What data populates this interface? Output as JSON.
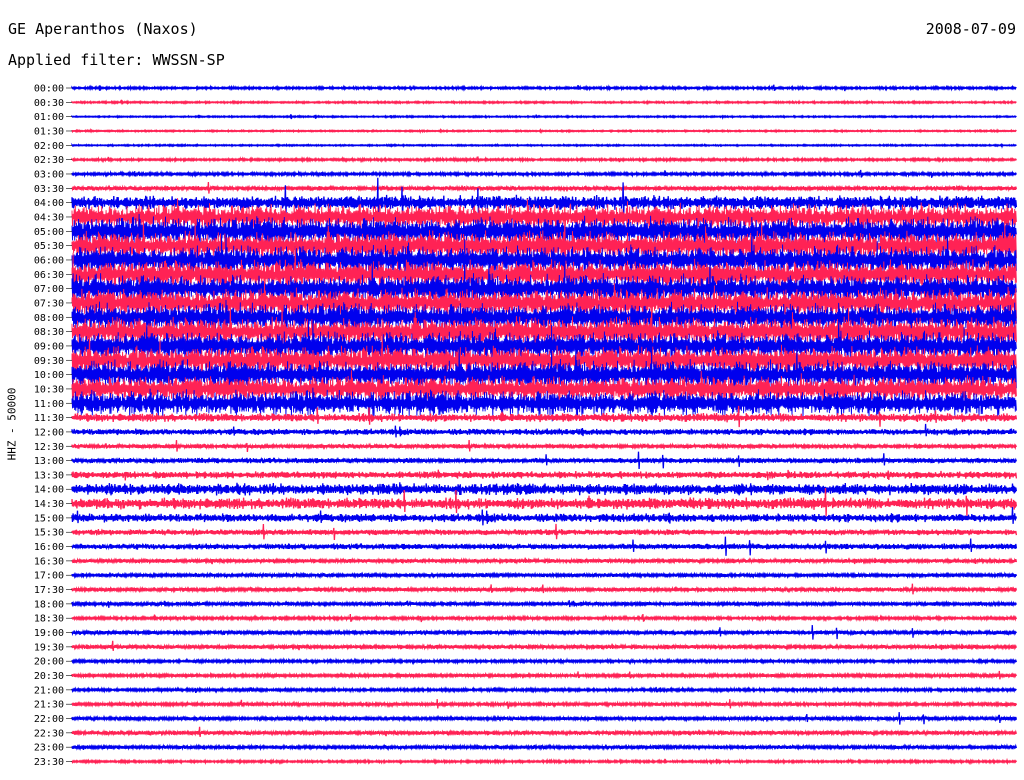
{
  "header": {
    "station": "GE Aperanthos (Naxos)",
    "date": "2008-07-09",
    "filter": "Applied filter: WWSSN-SP"
  },
  "colors": {
    "trace_a": "#0000ee",
    "trace_b": "#ff2255",
    "background": "#ffffff",
    "text": "#000000"
  },
  "chart_data": {
    "type": "line",
    "title": "GE Aperanthos (Naxos)",
    "subtitle": "Applied filter: WWSSN-SP",
    "date": "2008-07-09",
    "ylabel": "HHZ - 50000",
    "xlabel": "",
    "grid": false,
    "legend": "none",
    "rows": [
      {
        "label": "00:00",
        "color": "blue",
        "amplitude": 0.08
      },
      {
        "label": "00:30",
        "color": "red",
        "amplitude": 0.06
      },
      {
        "label": "01:00",
        "color": "blue",
        "amplitude": 0.05
      },
      {
        "label": "01:30",
        "color": "red",
        "amplitude": 0.05
      },
      {
        "label": "02:00",
        "color": "blue",
        "amplitude": 0.05
      },
      {
        "label": "02:30",
        "color": "red",
        "amplitude": 0.08
      },
      {
        "label": "03:00",
        "color": "blue",
        "amplitude": 0.1
      },
      {
        "label": "03:30",
        "color": "red",
        "amplitude": 0.15
      },
      {
        "label": "04:00",
        "color": "blue",
        "amplitude": 0.5
      },
      {
        "label": "04:30",
        "color": "red",
        "amplitude": 0.9
      },
      {
        "label": "05:00",
        "color": "blue",
        "amplitude": 1.0
      },
      {
        "label": "05:30",
        "color": "red",
        "amplitude": 1.0
      },
      {
        "label": "06:00",
        "color": "blue",
        "amplitude": 1.0
      },
      {
        "label": "06:30",
        "color": "red",
        "amplitude": 1.0
      },
      {
        "label": "07:00",
        "color": "blue",
        "amplitude": 1.0
      },
      {
        "label": "07:30",
        "color": "red",
        "amplitude": 1.0
      },
      {
        "label": "08:00",
        "color": "blue",
        "amplitude": 1.0
      },
      {
        "label": "08:30",
        "color": "red",
        "amplitude": 1.0
      },
      {
        "label": "09:00",
        "color": "blue",
        "amplitude": 1.0
      },
      {
        "label": "09:30",
        "color": "red",
        "amplitude": 1.0
      },
      {
        "label": "10:00",
        "color": "blue",
        "amplitude": 1.0
      },
      {
        "label": "10:30",
        "color": "red",
        "amplitude": 0.9
      },
      {
        "label": "11:00",
        "color": "blue",
        "amplitude": 0.9
      },
      {
        "label": "11:30",
        "color": "red",
        "amplitude": 0.3
      },
      {
        "label": "12:00",
        "color": "blue",
        "amplitude": 0.22
      },
      {
        "label": "12:30",
        "color": "red",
        "amplitude": 0.15
      },
      {
        "label": "13:00",
        "color": "blue",
        "amplitude": 0.18
      },
      {
        "label": "13:30",
        "color": "red",
        "amplitude": 0.25
      },
      {
        "label": "14:00",
        "color": "blue",
        "amplitude": 0.4
      },
      {
        "label": "14:30",
        "color": "red",
        "amplitude": 0.4
      },
      {
        "label": "15:00",
        "color": "blue",
        "amplitude": 0.3
      },
      {
        "label": "15:30",
        "color": "red",
        "amplitude": 0.2
      },
      {
        "label": "16:00",
        "color": "blue",
        "amplitude": 0.2
      },
      {
        "label": "16:30",
        "color": "red",
        "amplitude": 0.15
      },
      {
        "label": "17:00",
        "color": "blue",
        "amplitude": 0.13
      },
      {
        "label": "17:30",
        "color": "red",
        "amplitude": 0.15
      },
      {
        "label": "18:00",
        "color": "blue",
        "amplitude": 0.13
      },
      {
        "label": "18:30",
        "color": "red",
        "amplitude": 0.1
      },
      {
        "label": "19:00",
        "color": "blue",
        "amplitude": 0.15
      },
      {
        "label": "19:30",
        "color": "red",
        "amplitude": 0.15
      },
      {
        "label": "20:00",
        "color": "blue",
        "amplitude": 0.1
      },
      {
        "label": "20:30",
        "color": "red",
        "amplitude": 0.12
      },
      {
        "label": "21:00",
        "color": "blue",
        "amplitude": 0.1
      },
      {
        "label": "21:30",
        "color": "red",
        "amplitude": 0.12
      },
      {
        "label": "22:00",
        "color": "blue",
        "amplitude": 0.13
      },
      {
        "label": "22:30",
        "color": "red",
        "amplitude": 0.15
      },
      {
        "label": "23:00",
        "color": "blue",
        "amplitude": 0.13
      },
      {
        "label": "23:30",
        "color": "red",
        "amplitude": 0.08
      }
    ]
  }
}
